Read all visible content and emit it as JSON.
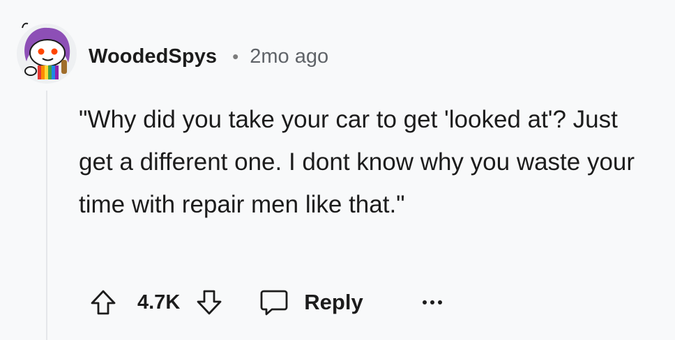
{
  "comment": {
    "username": "WoodedSpys",
    "separator": "•",
    "timestamp": "2mo ago",
    "body": "\"Why did you take your car to get 'looked at'? Just get a different one. I dont know why you waste your time with repair men like that.\"",
    "score": "4.7K",
    "reply_label": "Reply",
    "avatar_icon": "snoo-avatar-icon",
    "colors": {
      "text": "#1c1c1c",
      "muted": "#5f6368",
      "background": "#f8f9fa"
    }
  }
}
